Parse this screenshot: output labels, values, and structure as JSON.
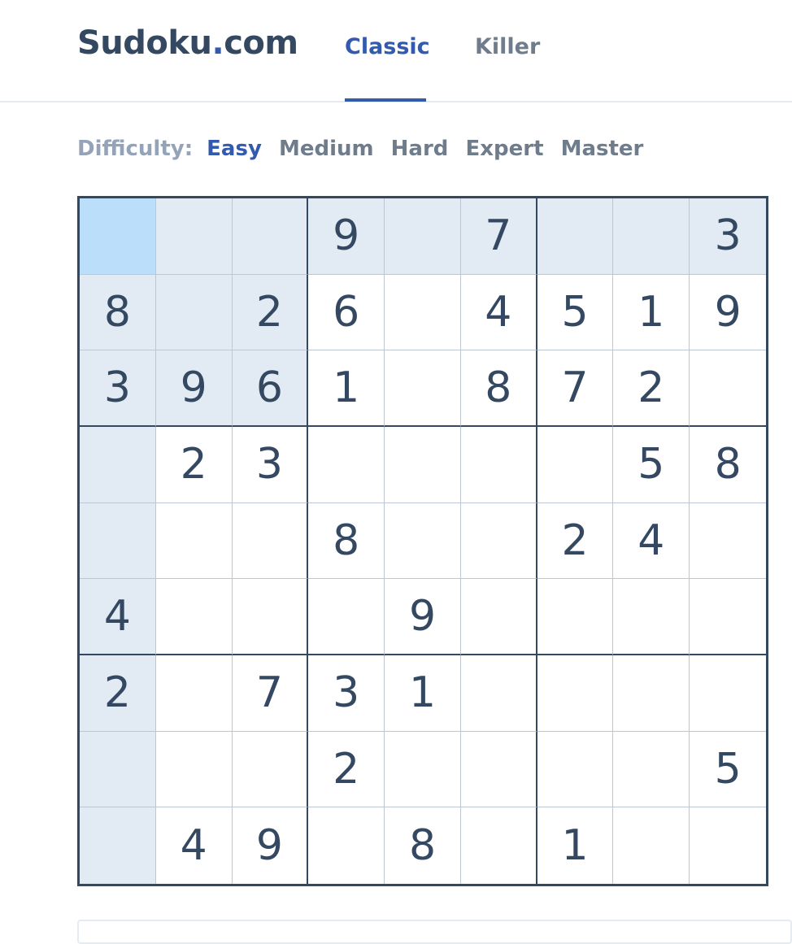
{
  "header": {
    "logo_main": "Sudoku",
    "logo_dot": ".",
    "logo_tld": "com",
    "tabs": [
      {
        "label": "Classic",
        "active": true
      },
      {
        "label": "Killer",
        "active": false
      }
    ]
  },
  "difficulty": {
    "label": "Difficulty:",
    "options": [
      {
        "label": "Easy",
        "active": true
      },
      {
        "label": "Medium",
        "active": false
      },
      {
        "label": "Hard",
        "active": false
      },
      {
        "label": "Expert",
        "active": false
      },
      {
        "label": "Master",
        "active": false
      }
    ]
  },
  "board": {
    "selected_cell": {
      "row": 1,
      "col": 1
    },
    "rows": [
      [
        "",
        "",
        "",
        "9",
        "",
        "7",
        "",
        "",
        "3"
      ],
      [
        "8",
        "",
        "2",
        "6",
        "",
        "4",
        "5",
        "1",
        "9"
      ],
      [
        "3",
        "9",
        "6",
        "1",
        "",
        "8",
        "7",
        "2",
        ""
      ],
      [
        "",
        "2",
        "3",
        "",
        "",
        "",
        "",
        "5",
        "8"
      ],
      [
        "",
        "",
        "",
        "8",
        "",
        "",
        "2",
        "4",
        ""
      ],
      [
        "4",
        "",
        "",
        "",
        "9",
        "",
        "",
        "",
        ""
      ],
      [
        "2",
        "",
        "7",
        "3",
        "1",
        "",
        "",
        "",
        ""
      ],
      [
        "",
        "",
        "",
        "2",
        "",
        "",
        "",
        "",
        "5"
      ],
      [
        "",
        "4",
        "9",
        "",
        "8",
        "",
        "1",
        "",
        ""
      ]
    ]
  },
  "colors": {
    "accent": "#325aaf",
    "text": "#344861",
    "highlight": "#e2ebf3",
    "selected": "#bbdefb"
  }
}
